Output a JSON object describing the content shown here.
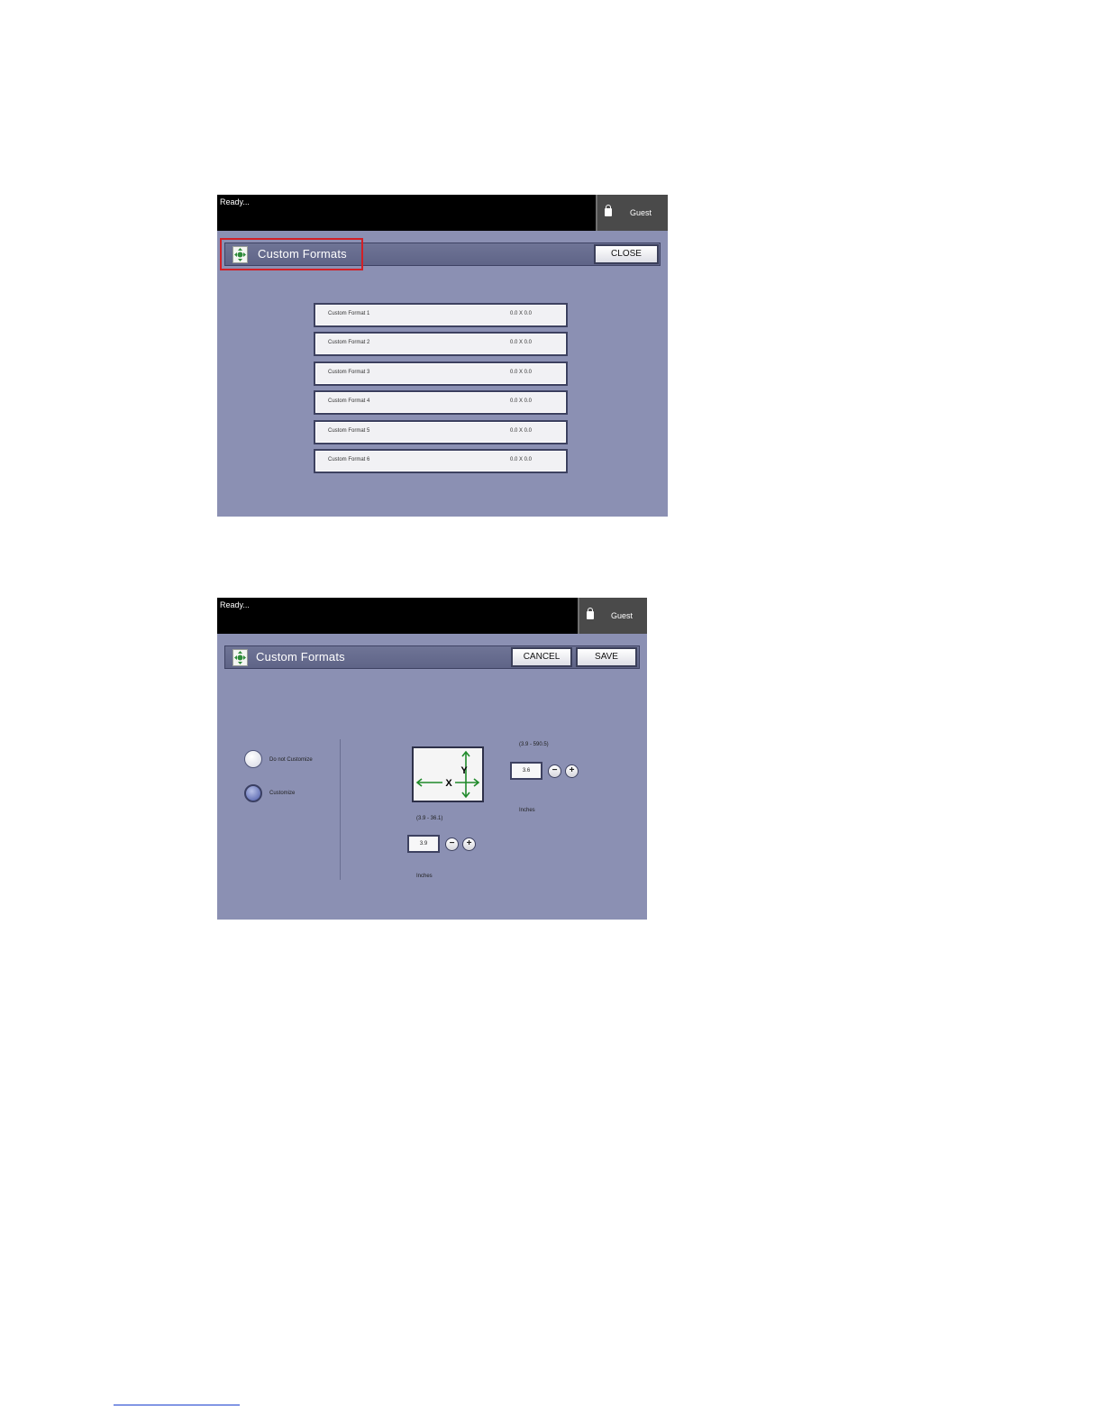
{
  "screen1": {
    "status": "Ready...",
    "user": "Guest",
    "title": "Custom Formats",
    "close_label": "CLOSE",
    "formats": [
      {
        "name": "Custom Format  1",
        "size": "0.0 X 0.0"
      },
      {
        "name": "Custom Format  2",
        "size": "0.0 X 0.0"
      },
      {
        "name": "Custom Format  3",
        "size": "0.0 X 0.0"
      },
      {
        "name": "Custom Format  4",
        "size": "0.0 X 0.0"
      },
      {
        "name": "Custom Format  5",
        "size": "0.0 X 0.0"
      },
      {
        "name": "Custom Format  6",
        "size": "0.0 X 0.0"
      }
    ]
  },
  "screen2": {
    "status": "Ready...",
    "user": "Guest",
    "title": "Custom Formats",
    "cancel_label": "CANCEL",
    "save_label": "SAVE",
    "options": {
      "do_not_customize": "Do not Customize",
      "customize": "Customize",
      "selected": "customize"
    },
    "diagram": {
      "x_label": "X",
      "y_label": "Y"
    },
    "y_field": {
      "range": "(3.9 - 590.5)",
      "value": "3.6",
      "unit": "Inches"
    },
    "x_field": {
      "range": "(3.9 - 36.1)",
      "value": "3.9",
      "unit": "Inches"
    },
    "minus": "−",
    "plus": "+"
  },
  "colors": {
    "panel": "#8b90b3",
    "highlight": "#d22026",
    "arrow": "#1f8a2a"
  }
}
